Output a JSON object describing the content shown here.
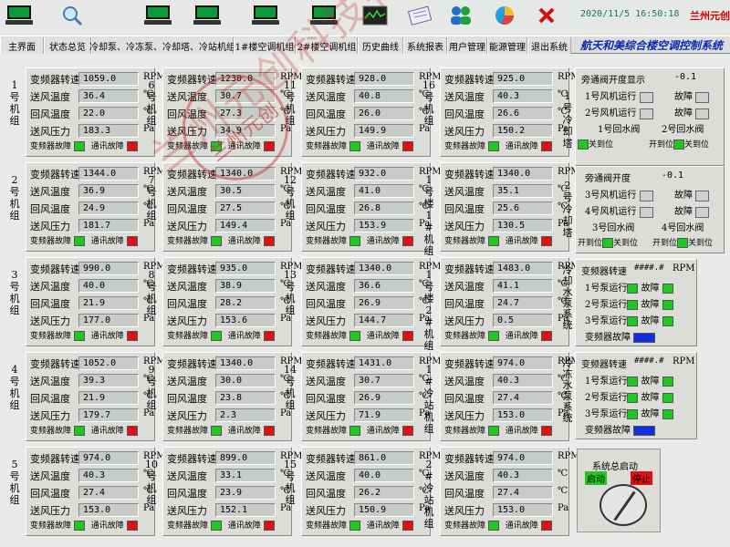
{
  "toolbar": {
    "datetime": "2020/11/5  16:50:18",
    "brand": "兰州元创",
    "icons": [
      "computer-icon",
      "search-icon",
      "computer-icon",
      "computer-icon",
      "computer-icon",
      "computer-icon",
      "monitor-icon",
      "report-icon",
      "users-icon",
      "pie-icon",
      "close-icon"
    ]
  },
  "menu": {
    "items": [
      "主界面",
      "状态总览",
      "冷却泵、冷冻泵、冷却塔、冷站机组",
      "1#楼空调机组",
      "2#楼空调机组",
      "历史曲线",
      "系统报表",
      "用户管理",
      "能源管理",
      "退出系统"
    ],
    "system_title": "航天和美综合楼空调控制系统"
  },
  "common": {
    "speed": "变频器转速",
    "supply_temp": "送风温度",
    "return_temp": "回风温度",
    "pressure": "送风压力",
    "rpm": "RPM",
    "celsius": "℃",
    "pa": "Pa",
    "vfd_fault": "变频器故障",
    "comm_fault": "通讯故障"
  },
  "units": [
    {
      "label": "1号机组",
      "speed": "1059.0",
      "supply": "36.4",
      "return": "22.0",
      "pressure": "183.3"
    },
    {
      "label": "2号机组",
      "speed": "1344.0",
      "supply": "36.9",
      "return": "24.9",
      "pressure": "181.7"
    },
    {
      "label": "3号机组",
      "speed": "990.0",
      "supply": "40.0",
      "return": "21.9",
      "pressure": "177.0"
    },
    {
      "label": "4号机组",
      "speed": "1052.0",
      "supply": "39.3",
      "return": "21.9",
      "pressure": "179.7"
    },
    {
      "label": "5号机组",
      "speed": "974.0",
      "supply": "40.3",
      "return": "27.4",
      "pressure": "153.0"
    },
    {
      "label": "6号机组",
      "speed": "1230.0",
      "supply": "30.7",
      "return": "27.3",
      "pressure": "34.9"
    },
    {
      "label": "7号机组",
      "speed": "1340.0",
      "supply": "30.5",
      "return": "27.5",
      "pressure": "149.4"
    },
    {
      "label": "8号机组",
      "speed": "935.0",
      "supply": "38.9",
      "return": "28.2",
      "pressure": "153.6"
    },
    {
      "label": "9号机组",
      "speed": "1340.0",
      "supply": "30.0",
      "return": "23.8",
      "pressure": "2.3"
    },
    {
      "label": "10号机组",
      "speed": "899.0",
      "supply": "33.1",
      "return": "23.9",
      "pressure": "152.1"
    },
    {
      "label": "11号机组",
      "speed": "928.0",
      "supply": "40.8",
      "return": "26.0",
      "pressure": "149.9"
    },
    {
      "label": "12号机组",
      "speed": "932.0",
      "supply": "41.0",
      "return": "26.8",
      "pressure": "153.9"
    },
    {
      "label": "13号机组",
      "speed": "1340.0",
      "supply": "36.6",
      "return": "26.9",
      "pressure": "144.7"
    },
    {
      "label": "14号机组",
      "speed": "1431.0",
      "supply": "30.7",
      "return": "26.9",
      "pressure": "71.9"
    },
    {
      "label": "15号机组",
      "speed": "861.0",
      "supply": "40.0",
      "return": "26.2",
      "pressure": "150.9"
    },
    {
      "label": "16号机组",
      "speed": "925.0",
      "supply": "40.3",
      "return": "26.6",
      "pressure": "150.2"
    },
    {
      "label": "1号楼1#机组",
      "speed": "1340.0",
      "supply": "35.1",
      "return": "25.6",
      "pressure": "130.5"
    },
    {
      "label": "1号楼2#机组",
      "speed": "1483.0",
      "supply": "41.1",
      "return": "24.7",
      "pressure": "0.5"
    },
    {
      "label": "1#冷站机组",
      "speed": "974.0",
      "supply": "40.3",
      "return": "27.4",
      "pressure": "153.0"
    },
    {
      "label": "2#冷站机组",
      "speed": "974.0",
      "supply": "40.3",
      "return": "27.4",
      "pressure": "153.0"
    }
  ],
  "cooling_tower_1": {
    "title": "1号冷却塔",
    "bypass": "旁通阀开度显示",
    "bypass_val": "-0.1",
    "fan1": "1号风机运行",
    "fan2": "2号风机运行",
    "fault": "故障",
    "valve1": "1号回水阀",
    "valve2": "2号回水阀",
    "open": "开到位",
    "close": "关到位"
  },
  "cooling_tower_2": {
    "title": "2号冷却塔",
    "bypass": "旁通阀开度",
    "bypass_val": "-0.1",
    "fan1": "3号风机运行",
    "fan2": "4号风机运行",
    "fault": "故障",
    "valve1": "3号回水阀",
    "valve2": "4号回水阀",
    "open": "开到位",
    "close": "关到位"
  },
  "cooling_pump": {
    "title": "冷却水泵系统",
    "speed": "变频器转速",
    "speed_val": "####.#",
    "rpm": "RPM",
    "pump1": "1号泵运行",
    "pump2": "2号泵运行",
    "pump3": "3号泵运行",
    "fault": "故障",
    "vfd_fault": "变频器故障"
  },
  "chilled_pump": {
    "title": "冷冻水泵系统",
    "speed": "变频器转速",
    "speed_val": "####.#",
    "rpm": "RPM",
    "pump1": "1号泵运行",
    "pump2": "2号泵运行",
    "pump3": "3号泵运行",
    "fault": "故障",
    "vfd_fault": "变频器故障"
  },
  "system": {
    "title": "系统总启动",
    "start": "启动",
    "stop": "停止"
  },
  "watermark": {
    "text": "兰州元创科技有限公司",
    "stamp": "兰州元创"
  },
  "colors": {
    "ok": "#1ec81e",
    "alarm": "#e01010",
    "blue": "#1030e0"
  }
}
